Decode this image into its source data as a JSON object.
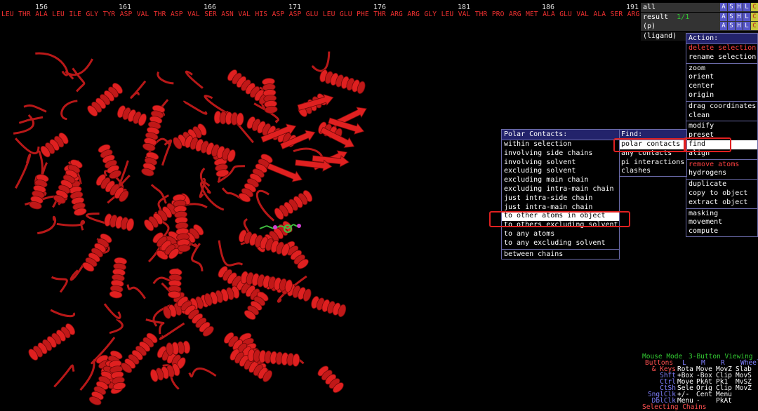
{
  "sequence": {
    "numbers": [
      "156",
      "161",
      "166",
      "171",
      "176",
      "181",
      "186",
      "191"
    ],
    "residues": [
      "LEU",
      "THR",
      "ALA",
      "LEU",
      "ILE",
      "GLY",
      "TYR",
      "ASP",
      "VAL",
      "THR",
      "ASP",
      "VAL",
      "SER",
      "ASN",
      "VAL",
      "HIS",
      "ASP",
      "ASP",
      "GLU",
      "LEU",
      "GLU",
      "PHE",
      "THR",
      "ARG",
      "ARG",
      "GLY",
      "LEU",
      "VAL",
      "THR",
      "PRO",
      "ARG",
      "MET",
      "ALA",
      "GLU",
      "VAL",
      "ALA",
      "SER",
      "ARG"
    ]
  },
  "objects": [
    {
      "name": "all",
      "count": "",
      "buttons": [
        "A",
        "S",
        "H",
        "L",
        "C"
      ]
    },
    {
      "name": "result",
      "count": "1/1",
      "buttons": [
        "A",
        "S",
        "H",
        "L",
        "C"
      ]
    },
    {
      "name": "(p)",
      "count": "",
      "buttons": [
        "A",
        "S",
        "H",
        "L",
        "C"
      ]
    },
    {
      "name": "(ligand)",
      "count": "",
      "buttons": []
    }
  ],
  "action_menu": {
    "title": "Action:",
    "groups": [
      [
        {
          "label": "delete selection",
          "red": true
        },
        {
          "label": "rename selection"
        }
      ],
      [
        {
          "label": "zoom"
        },
        {
          "label": "orient"
        },
        {
          "label": "center"
        },
        {
          "label": "origin"
        }
      ],
      [
        {
          "label": "drag coordinates"
        },
        {
          "label": "clean"
        }
      ],
      [
        {
          "label": "modify"
        },
        {
          "label": "preset"
        },
        {
          "label": "find",
          "selected": true
        },
        {
          "label": "align"
        }
      ],
      [
        {
          "label": "remove atoms",
          "red": true
        },
        {
          "label": "hydrogens"
        }
      ],
      [
        {
          "label": "duplicate"
        },
        {
          "label": "copy to object"
        },
        {
          "label": "extract object"
        }
      ],
      [
        {
          "label": "masking"
        },
        {
          "label": "movement"
        },
        {
          "label": "compute"
        }
      ]
    ]
  },
  "find_menu": {
    "title": "Find:",
    "items": [
      {
        "label": "polar contacts",
        "selected": true
      },
      {
        "label": "any contacts"
      },
      {
        "label": "pi interactions"
      },
      {
        "label": "clashes"
      }
    ]
  },
  "polar_menu": {
    "title": "Polar Contacts:",
    "items": [
      {
        "label": "within selection"
      },
      {
        "label": "involving side chains"
      },
      {
        "label": "involving solvent"
      },
      {
        "label": "excluding solvent"
      },
      {
        "label": "excluding main chain"
      },
      {
        "label": "excluding intra-main chain"
      },
      {
        "label": "just intra-side chain"
      },
      {
        "label": "just intra-main chain"
      },
      {
        "label": "to other atoms in object",
        "selected": true
      },
      {
        "label": "to others excluding solvent"
      },
      {
        "label": "to any atoms"
      },
      {
        "label": "to any excluding solvent"
      }
    ],
    "extra": [
      {
        "label": "between chains"
      }
    ]
  },
  "mouse_mode": {
    "title": "Mouse Mode",
    "mode": "3-Button Viewing",
    "header": [
      "Buttons",
      "L",
      "M",
      "R",
      "Wheel"
    ],
    "rows": [
      [
        "& Keys",
        "Rota",
        "Move",
        "MovZ",
        "Slab"
      ],
      [
        "Shft",
        "+Box",
        "-Box",
        "Clip",
        "MovS"
      ],
      [
        "Ctrl",
        "Move",
        "PkAt",
        "Pk1",
        "MvSZ"
      ],
      [
        "CtSh",
        "Sele",
        "Orig",
        "Clip",
        "MovZ"
      ],
      [
        "SnglClk",
        "+/-",
        "Cent",
        "Menu",
        ""
      ],
      [
        "DblClk",
        "Menu",
        "-",
        "PkAt",
        ""
      ]
    ],
    "footer": "Selecting Chains"
  },
  "colors": {
    "protein": "#e02020",
    "ligand": "#40c040",
    "menu_title": "#23236b",
    "menu_border": "#6a6aa8",
    "highlight": "#e02020"
  }
}
